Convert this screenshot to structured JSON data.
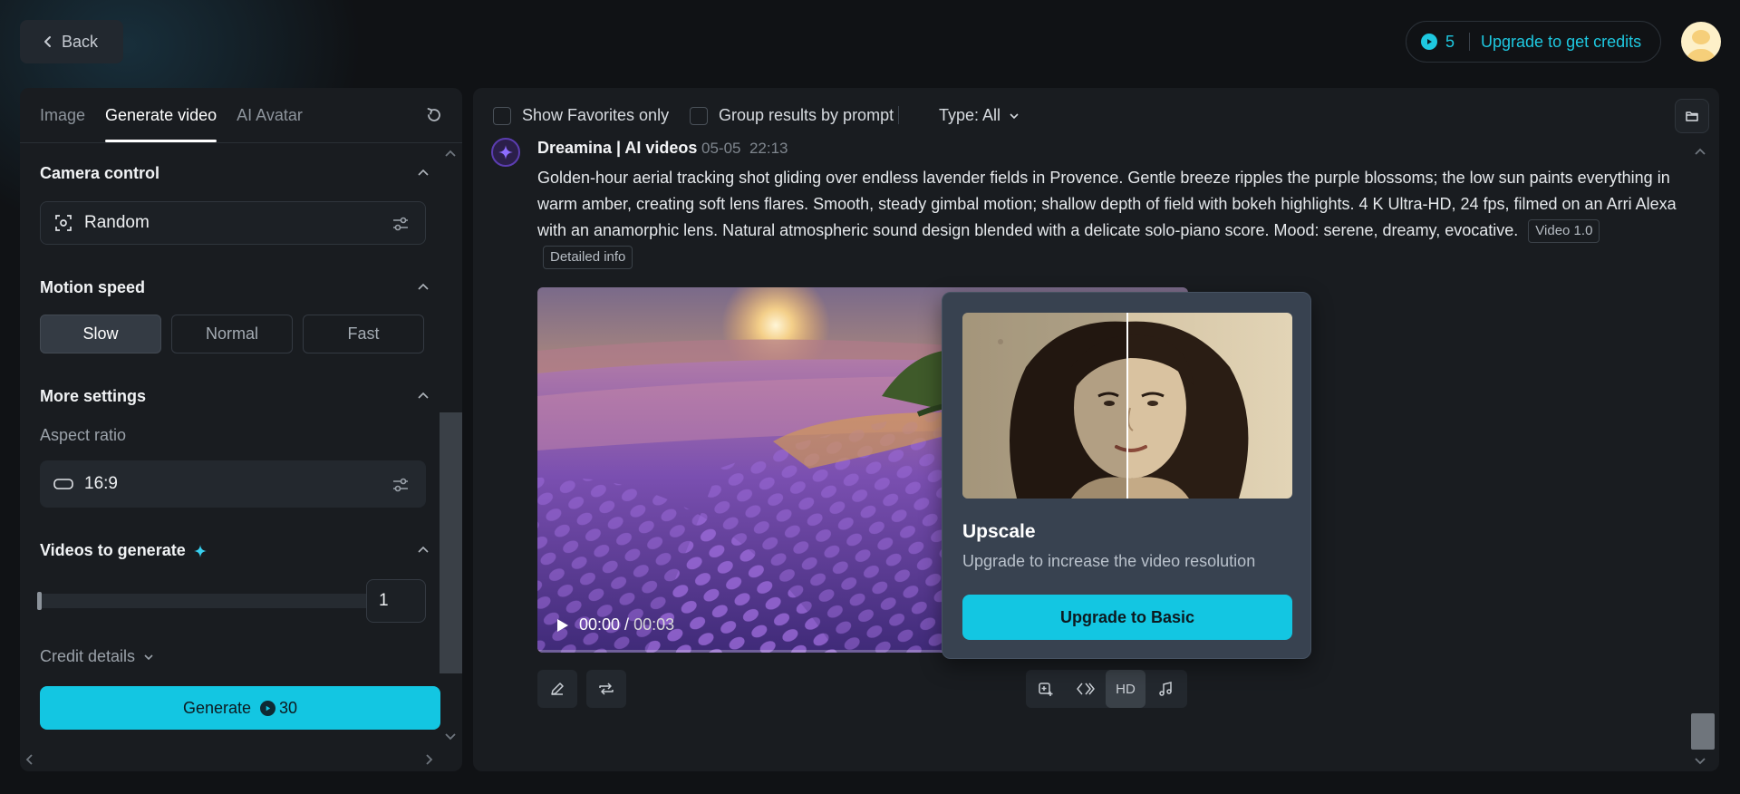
{
  "header": {
    "back_label": "Back",
    "credits": "5",
    "upgrade_label": "Upgrade to get credits"
  },
  "left_panel": {
    "tabs": [
      {
        "label": "Image"
      },
      {
        "label": "Generate video",
        "active": true
      },
      {
        "label": "AI Avatar"
      }
    ],
    "camera_control": {
      "title": "Camera control",
      "value": "Random"
    },
    "motion_speed": {
      "title": "Motion speed",
      "options": [
        "Slow",
        "Normal",
        "Fast"
      ],
      "selected": "Slow"
    },
    "more_settings": {
      "title": "More settings",
      "aspect_label": "Aspect ratio",
      "aspect_value": "16:9"
    },
    "videos_to_generate": {
      "title": "Videos to generate",
      "value": "1"
    },
    "credit_details_label": "Credit details",
    "generate": {
      "label": "Generate",
      "cost": "30"
    }
  },
  "main": {
    "filters": {
      "favorites": "Show Favorites only",
      "group": "Group results by prompt",
      "type": "Type: All"
    },
    "post": {
      "author": "Dreamina | AI videos",
      "date": "05-05",
      "time": "22:13",
      "prompt": "Golden-hour aerial tracking shot gliding over endless lavender fields in Provence. Gentle breeze ripples the purple blossoms; the low sun paints everything in warm amber, creating soft lens flares. Smooth, steady gimbal motion; shallow depth of field with bokeh highlights. 4 K Ultra-HD, 24 fps, filmed on an Arri Alexa with an anamorphic lens. Natural atmospheric sound design blended with a delicate solo-piano score. Mood: serene, dreamy, evocative.",
      "tags": [
        "Video 1.0",
        "Detailed info"
      ],
      "video_time": "00:00",
      "video_total": "00:03",
      "video_progress": 0
    },
    "tools": {
      "hd_label": "HD"
    }
  },
  "popup": {
    "title": "Upscale",
    "description": "Upgrade to increase the video resolution",
    "button": "Upgrade to Basic"
  },
  "colors": {
    "accent": "#13c6e2",
    "background": "#101215",
    "panel": "#191c20"
  }
}
